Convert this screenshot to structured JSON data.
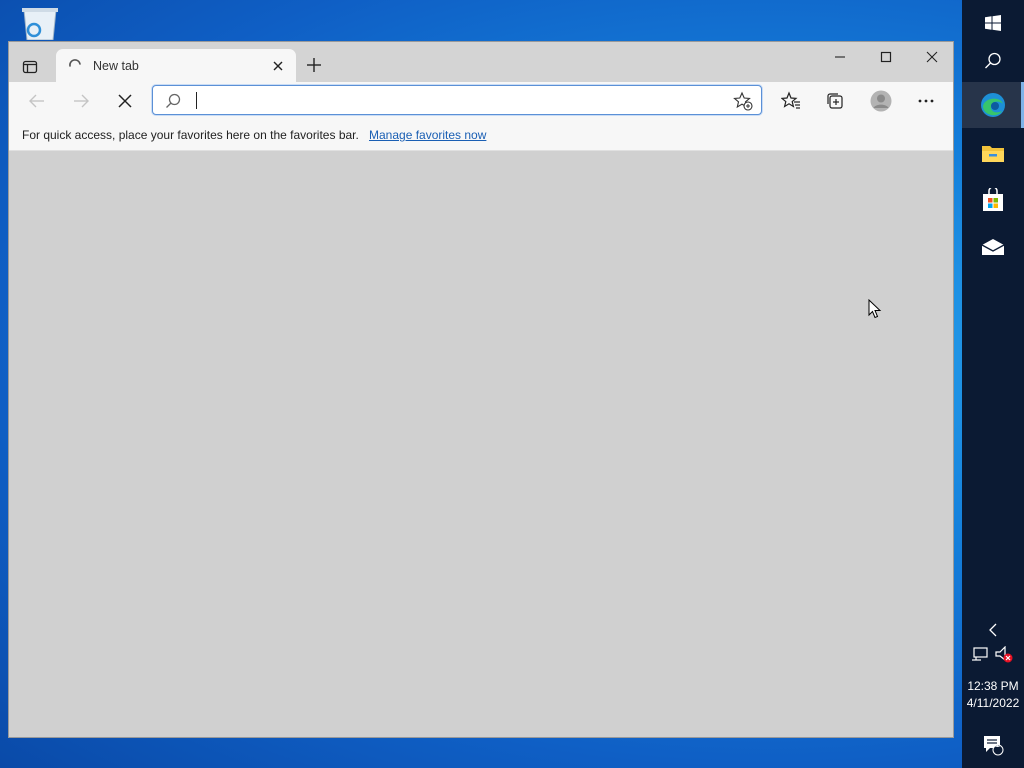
{
  "desktop": {
    "recycle_bin_icon": "recycle-bin-icon"
  },
  "browser": {
    "tab": {
      "title": "New tab",
      "loading": true
    },
    "address_bar": {
      "value": "",
      "placeholder": ""
    },
    "favorites_bar": {
      "message": "For quick access, place your favorites here on the favorites bar.",
      "link": "Manage favorites now"
    },
    "accent": "#5b90d6"
  },
  "taskbar": {
    "time": "12:38 PM",
    "date": "4/11/2022",
    "notification_count": "1",
    "apps": [
      "start-icon",
      "search-icon",
      "edge-icon",
      "file-explorer-icon",
      "store-icon",
      "mail-icon"
    ]
  }
}
